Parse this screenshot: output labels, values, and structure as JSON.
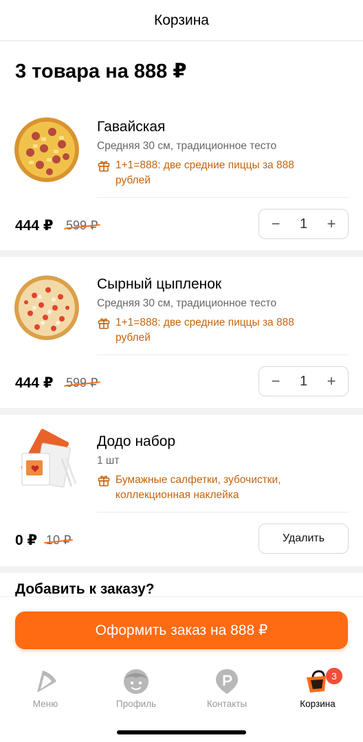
{
  "header": {
    "title": "Корзина"
  },
  "summary": {
    "title": "3 товара на 888 ₽"
  },
  "items": [
    {
      "name": "Гавайская",
      "description": "Средняя 30 см, традиционное тесто",
      "promo": "1+1=888: две средние пиццы за 888 рублей",
      "price": "444 ₽",
      "old_price": "599 ₽",
      "quantity": "1",
      "minus": "−",
      "plus": "+"
    },
    {
      "name": "Сырный цыпленок",
      "description": "Средняя 30 см, традиционное тесто",
      "promo": "1+1=888: две средние пиццы за 888 рублей",
      "price": "444 ₽",
      "old_price": "599 ₽",
      "quantity": "1",
      "minus": "−",
      "plus": "+"
    },
    {
      "name": "Додо набор",
      "description": "1 шт",
      "promo": "Бумажные салфетки, зубочистки, коллекционная наклейка",
      "price": "0 ₽",
      "old_price": "10 ₽",
      "action": "Удалить"
    }
  ],
  "add_section": {
    "title": "Добавить к заказу?"
  },
  "checkout": {
    "label": "Оформить заказ на 888 ₽"
  },
  "tabbar": {
    "tabs": [
      {
        "label": "Меню",
        "icon": "pizza-slice-icon"
      },
      {
        "label": "Профиль",
        "icon": "profile-face-icon"
      },
      {
        "label": "Контакты",
        "icon": "location-pin-icon"
      },
      {
        "label": "Корзина",
        "icon": "basket-icon",
        "badge": "3",
        "active": true
      }
    ]
  },
  "colors": {
    "accent": "#ff6b12",
    "promo": "#c5640f",
    "badge": "#f04e38"
  }
}
